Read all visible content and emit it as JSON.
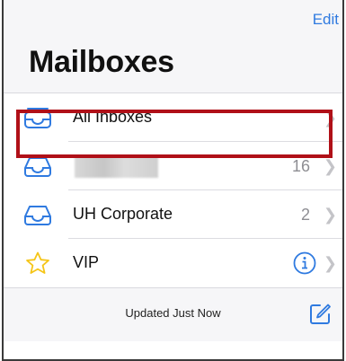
{
  "nav": {
    "edit_label": "Edit",
    "title": "Mailboxes"
  },
  "mailboxes": [
    {
      "label": "All Inboxes",
      "count": "",
      "icon": "tray-stack-icon"
    },
    {
      "label": "",
      "count": "16",
      "icon": "tray-icon"
    },
    {
      "label": "UH Corporate",
      "count": "2",
      "icon": "tray-icon"
    },
    {
      "label": "VIP",
      "count": "",
      "icon": "star-icon"
    }
  ],
  "toolbar": {
    "status": "Updated Just Now"
  },
  "colors": {
    "accent": "#2f7ae0",
    "highlight": "#b01018",
    "star": "#f5c518"
  }
}
